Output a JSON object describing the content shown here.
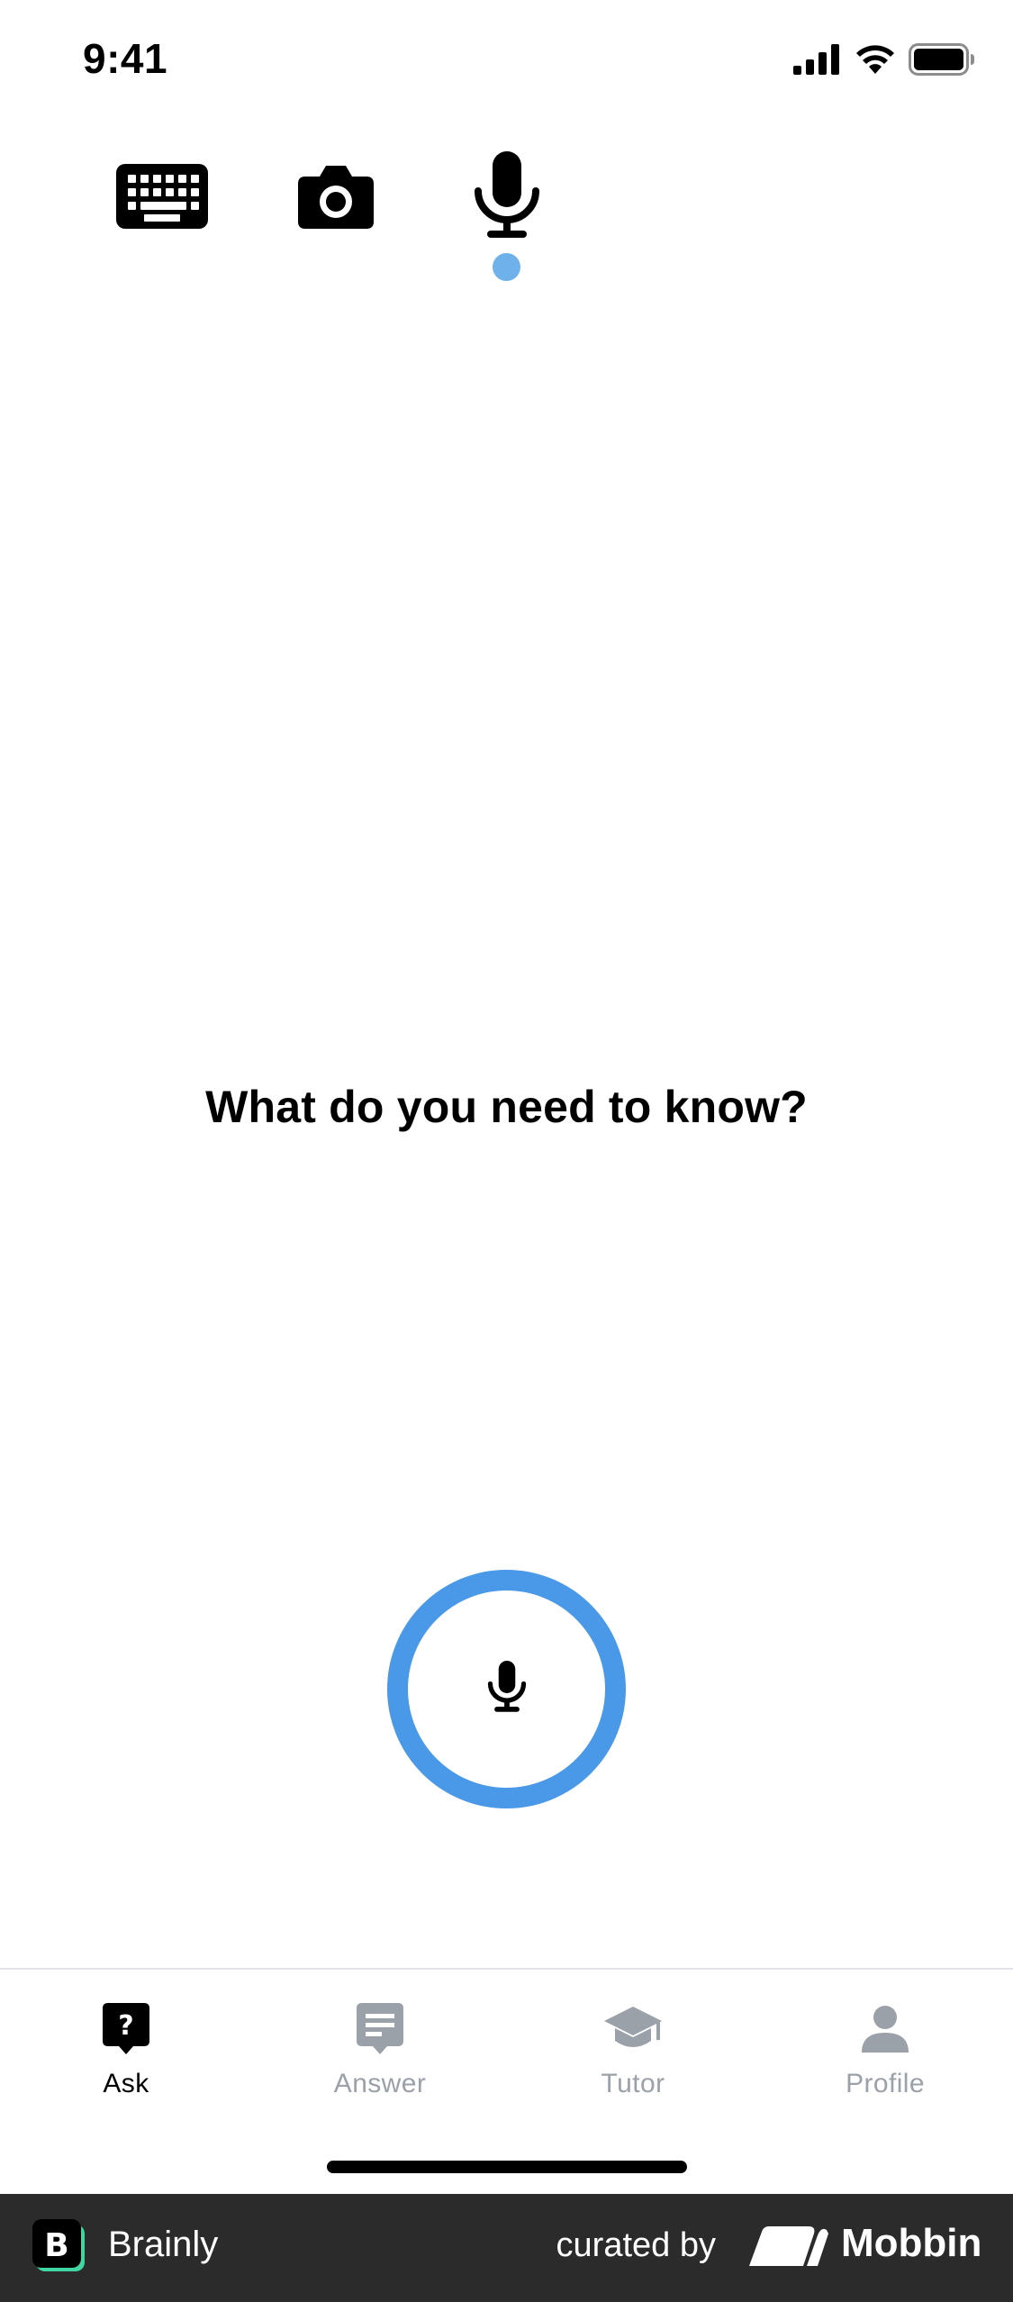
{
  "status_bar": {
    "time": "9:41"
  },
  "input_modes": {
    "items": [
      {
        "id": "keyboard",
        "icon": "keyboard-icon"
      },
      {
        "id": "camera",
        "icon": "camera-icon"
      },
      {
        "id": "voice",
        "icon": "microphone-icon",
        "selected": true
      }
    ],
    "indicator_color": "#6fb1ea"
  },
  "prompt": {
    "title": "What do you need to know?"
  },
  "record_button": {
    "icon": "microphone-icon",
    "ring_color": "#4a98e8"
  },
  "tab_bar": {
    "tabs": [
      {
        "label": "Ask",
        "icon": "question-bubble-icon",
        "active": true
      },
      {
        "label": "Answer",
        "icon": "answer-bubble-icon",
        "active": false
      },
      {
        "label": "Tutor",
        "icon": "graduation-cap-icon",
        "active": false
      },
      {
        "label": "Profile",
        "icon": "person-icon",
        "active": false
      }
    ],
    "active_color": "#000000",
    "inactive_color": "#9aa1a9"
  },
  "footer": {
    "brand_name": "Brainly",
    "curated_label": "curated by",
    "curator_name": "Mobbin",
    "background": "#2b2b2b"
  }
}
